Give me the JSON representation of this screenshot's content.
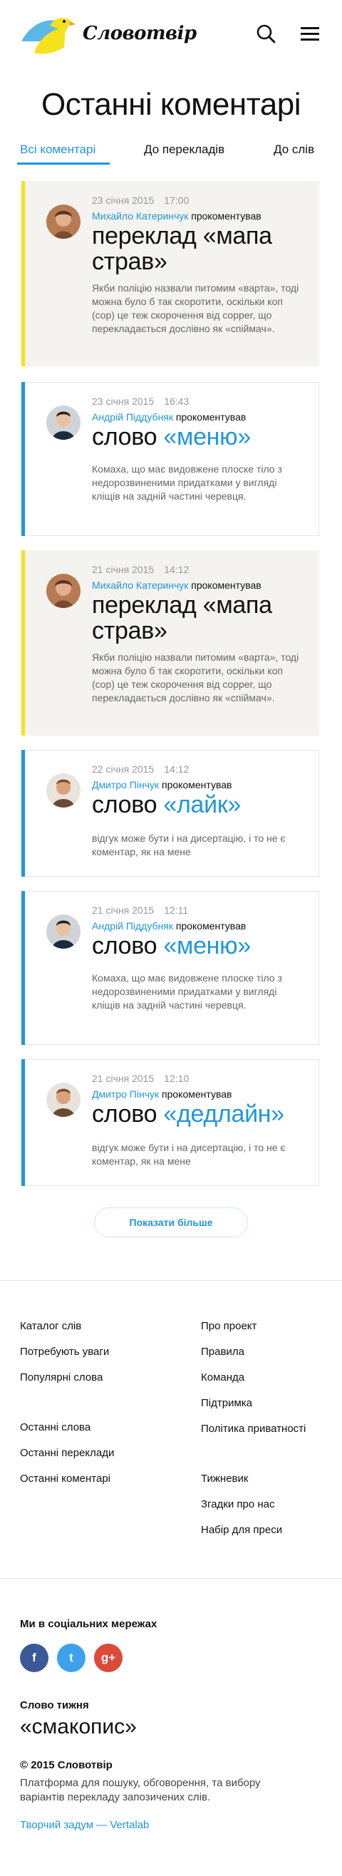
{
  "header": {
    "logo_text": "Словотвір",
    "search_icon": "search-icon",
    "menu_icon": "hamburger-menu-icon"
  },
  "page_title": "Останні коментарі",
  "tabs": [
    {
      "label": "Всі коментарі",
      "active": true
    },
    {
      "label": "До перекладів",
      "active": false
    },
    {
      "label": "До слів",
      "active": false
    }
  ],
  "comments": [
    {
      "type": "translation",
      "date": "23 січня 2015",
      "time": "17:00",
      "author": "Михайло Катеринчук",
      "action": "прокоментував",
      "headline": "переклад «мапа страв»",
      "text": "Якби поліцію назвали питомим «варта», тоді можна було б так скоротити, оскільки коп (cop) це теж скорочення від copper, що перекладається дослівно як «спіймач»."
    },
    {
      "type": "word",
      "date": "23 січня 2015",
      "time": "16:43",
      "author": "Андрій Піддубняк",
      "action": "прокоментував",
      "headline_prefix": "слово",
      "headline_word": "«меню»",
      "text": "Комаха, що має видовжене плоске тіло з недорозвиненими придатками у вигляді кліщів на задній частині черевця."
    },
    {
      "type": "translation",
      "date": "21 січня 2015",
      "time": "14:12",
      "author": "Михайло Катеринчук",
      "action": "прокоментував",
      "headline": "переклад «мапа страв»",
      "text": "Якби поліцію назвали питомим «варта», тоді можна було б так скоротити, оскільки коп (cop) це теж скорочення від copper, що перекладається дослівно як «спіймач»."
    },
    {
      "type": "word",
      "date": "22 січня 2015",
      "time": "14:12",
      "author": "Дмитро Пінчук",
      "action": "прокоментував",
      "headline_prefix": "слово",
      "headline_word": "«лайк»",
      "text": "відгук може бути і на дисертацію, і то не є коментар, як на мене"
    },
    {
      "type": "word",
      "date": "21 січня 2015",
      "time": "12:11",
      "author": "Андрій Піддубняк",
      "action": "прокоментував",
      "headline_prefix": "слово",
      "headline_word": "«меню»",
      "text": "Комаха, що має видовжене плоске тіло з недорозвиненими придатками у вигляді кліщів на задній частині черевця."
    },
    {
      "type": "word",
      "date": "21 січня 2015",
      "time": "12:10",
      "author": "Дмитро Пінчук",
      "action": "прокоментував",
      "headline_prefix": "слово",
      "headline_word": "«дедлайн»",
      "text": "відгук може бути і на дисертацію, і то не є коментар, як на мене"
    }
  ],
  "show_more_label": "Показати більше",
  "footer": {
    "left_links": [
      "Каталог слів",
      "Потребують уваги",
      "Популярні слова",
      "Останні слова",
      "Останні переклади",
      "Останні коментарі"
    ],
    "right_links": [
      "Про проект",
      "Правила",
      "Команда",
      "Підтримка",
      "Політика приватності",
      "Тижневик",
      "Згадки про нас",
      "Набір для преси"
    ],
    "social_title": "Ми в соціальних мережах",
    "social": [
      {
        "name": "facebook",
        "glyph": "f"
      },
      {
        "name": "twitter",
        "glyph": "t"
      },
      {
        "name": "google-plus",
        "glyph": "g+"
      }
    ],
    "word_of_week_title": "Слово тижня",
    "word_of_week": "«смакопис»",
    "copyright": "© 2015 Словотвір",
    "tagline": "Платформа для пошуку, обговорення, та вибору варіантів перекладу запозичених слів.",
    "credit": "Творчий задум — Vertalab"
  },
  "colors": {
    "accent_blue": "#2196d9",
    "accent_yellow": "#f5e21c",
    "translation_bg": "#f4f3ef"
  }
}
